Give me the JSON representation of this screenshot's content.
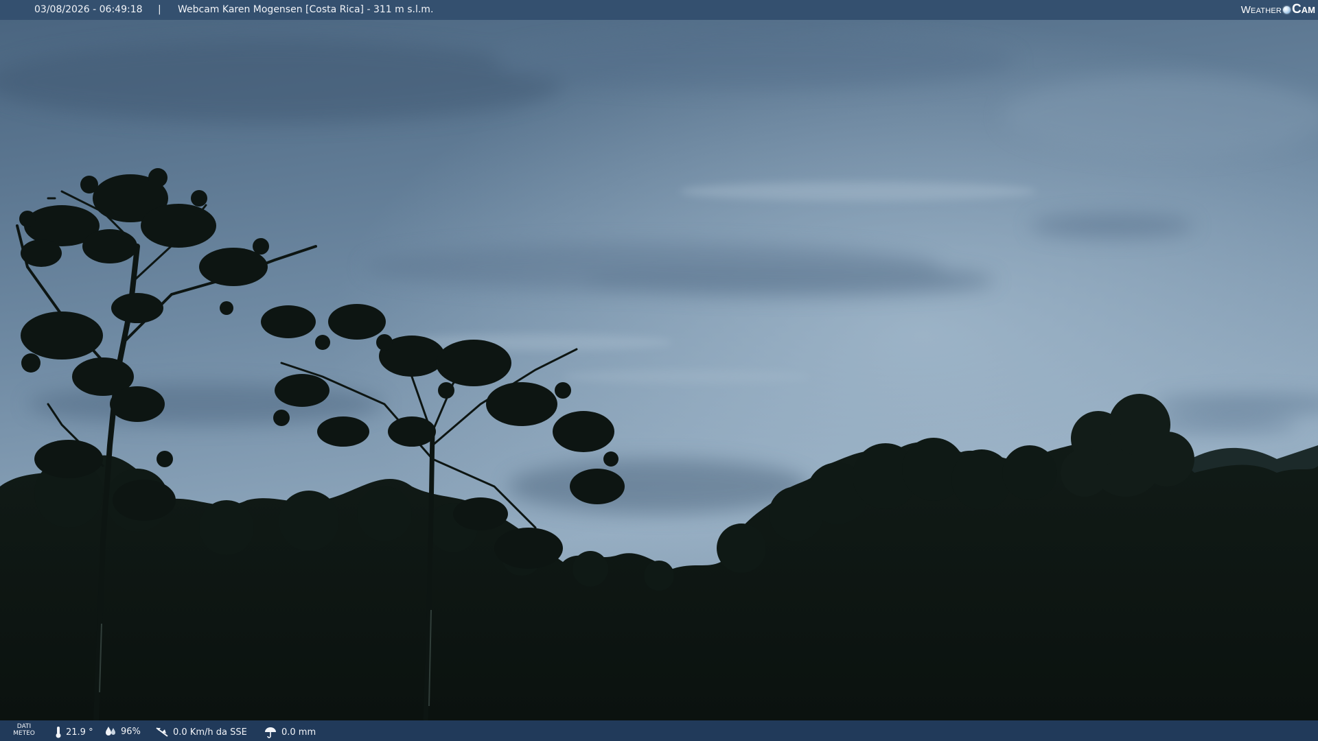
{
  "header": {
    "datetime": "03/08/2026 - 06:49:18",
    "separator": "|",
    "title": "Webcam Karen Mogensen [Costa Rica]  - 311 m s.l.m."
  },
  "logo": {
    "word_left": "Weather",
    "word_right": "Cam"
  },
  "weather": {
    "label_line1": "DATI",
    "label_line2": "METEO",
    "temperature": "21.9 °",
    "humidity": "96%",
    "wind": "0.0 Km/h da SSE",
    "rain": "0.0 mm"
  },
  "colors": {
    "topbar": "#34506f",
    "bottombar": "#213a5a",
    "sky_upper": "#4f6a85",
    "sky_lower": "#8fa8bd",
    "foliage": "#0d1512"
  }
}
